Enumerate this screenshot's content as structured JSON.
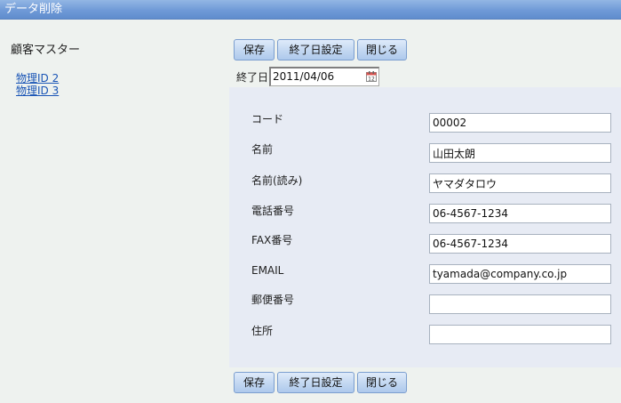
{
  "window": {
    "title": "データ削除"
  },
  "sidebar": {
    "title": "顧客マスター",
    "links": [
      {
        "label": "物理ID 2"
      },
      {
        "label": "物理ID 3"
      }
    ]
  },
  "toolbar": {
    "save_label": "保存",
    "end_date_label": "終了日設定",
    "close_label": "閉じる"
  },
  "end_date": {
    "label": "終了日",
    "value": "2011/04/06",
    "icon": "calendar-icon"
  },
  "form": {
    "fields": [
      {
        "label": "コード",
        "value": ""
      },
      {
        "label": "名前",
        "value": "山田太朗"
      },
      {
        "label": "名前(読み)",
        "value": "ヤマダタロウ"
      },
      {
        "label": "電話番号",
        "value": "06-4567-1234"
      },
      {
        "label": "FAX番号",
        "value": "06-4567-1234"
      },
      {
        "label": "EMAIL",
        "value": "tyamada@company.co.jp"
      },
      {
        "label": "郵便番号",
        "value": ""
      },
      {
        "label": "住所",
        "value": ""
      }
    ],
    "code_value": "00002"
  },
  "colors": {
    "title_bar": "#6f9ad7",
    "link": "#1a55b6",
    "panel": "#e7ebf4",
    "background": "#eef2ef"
  }
}
